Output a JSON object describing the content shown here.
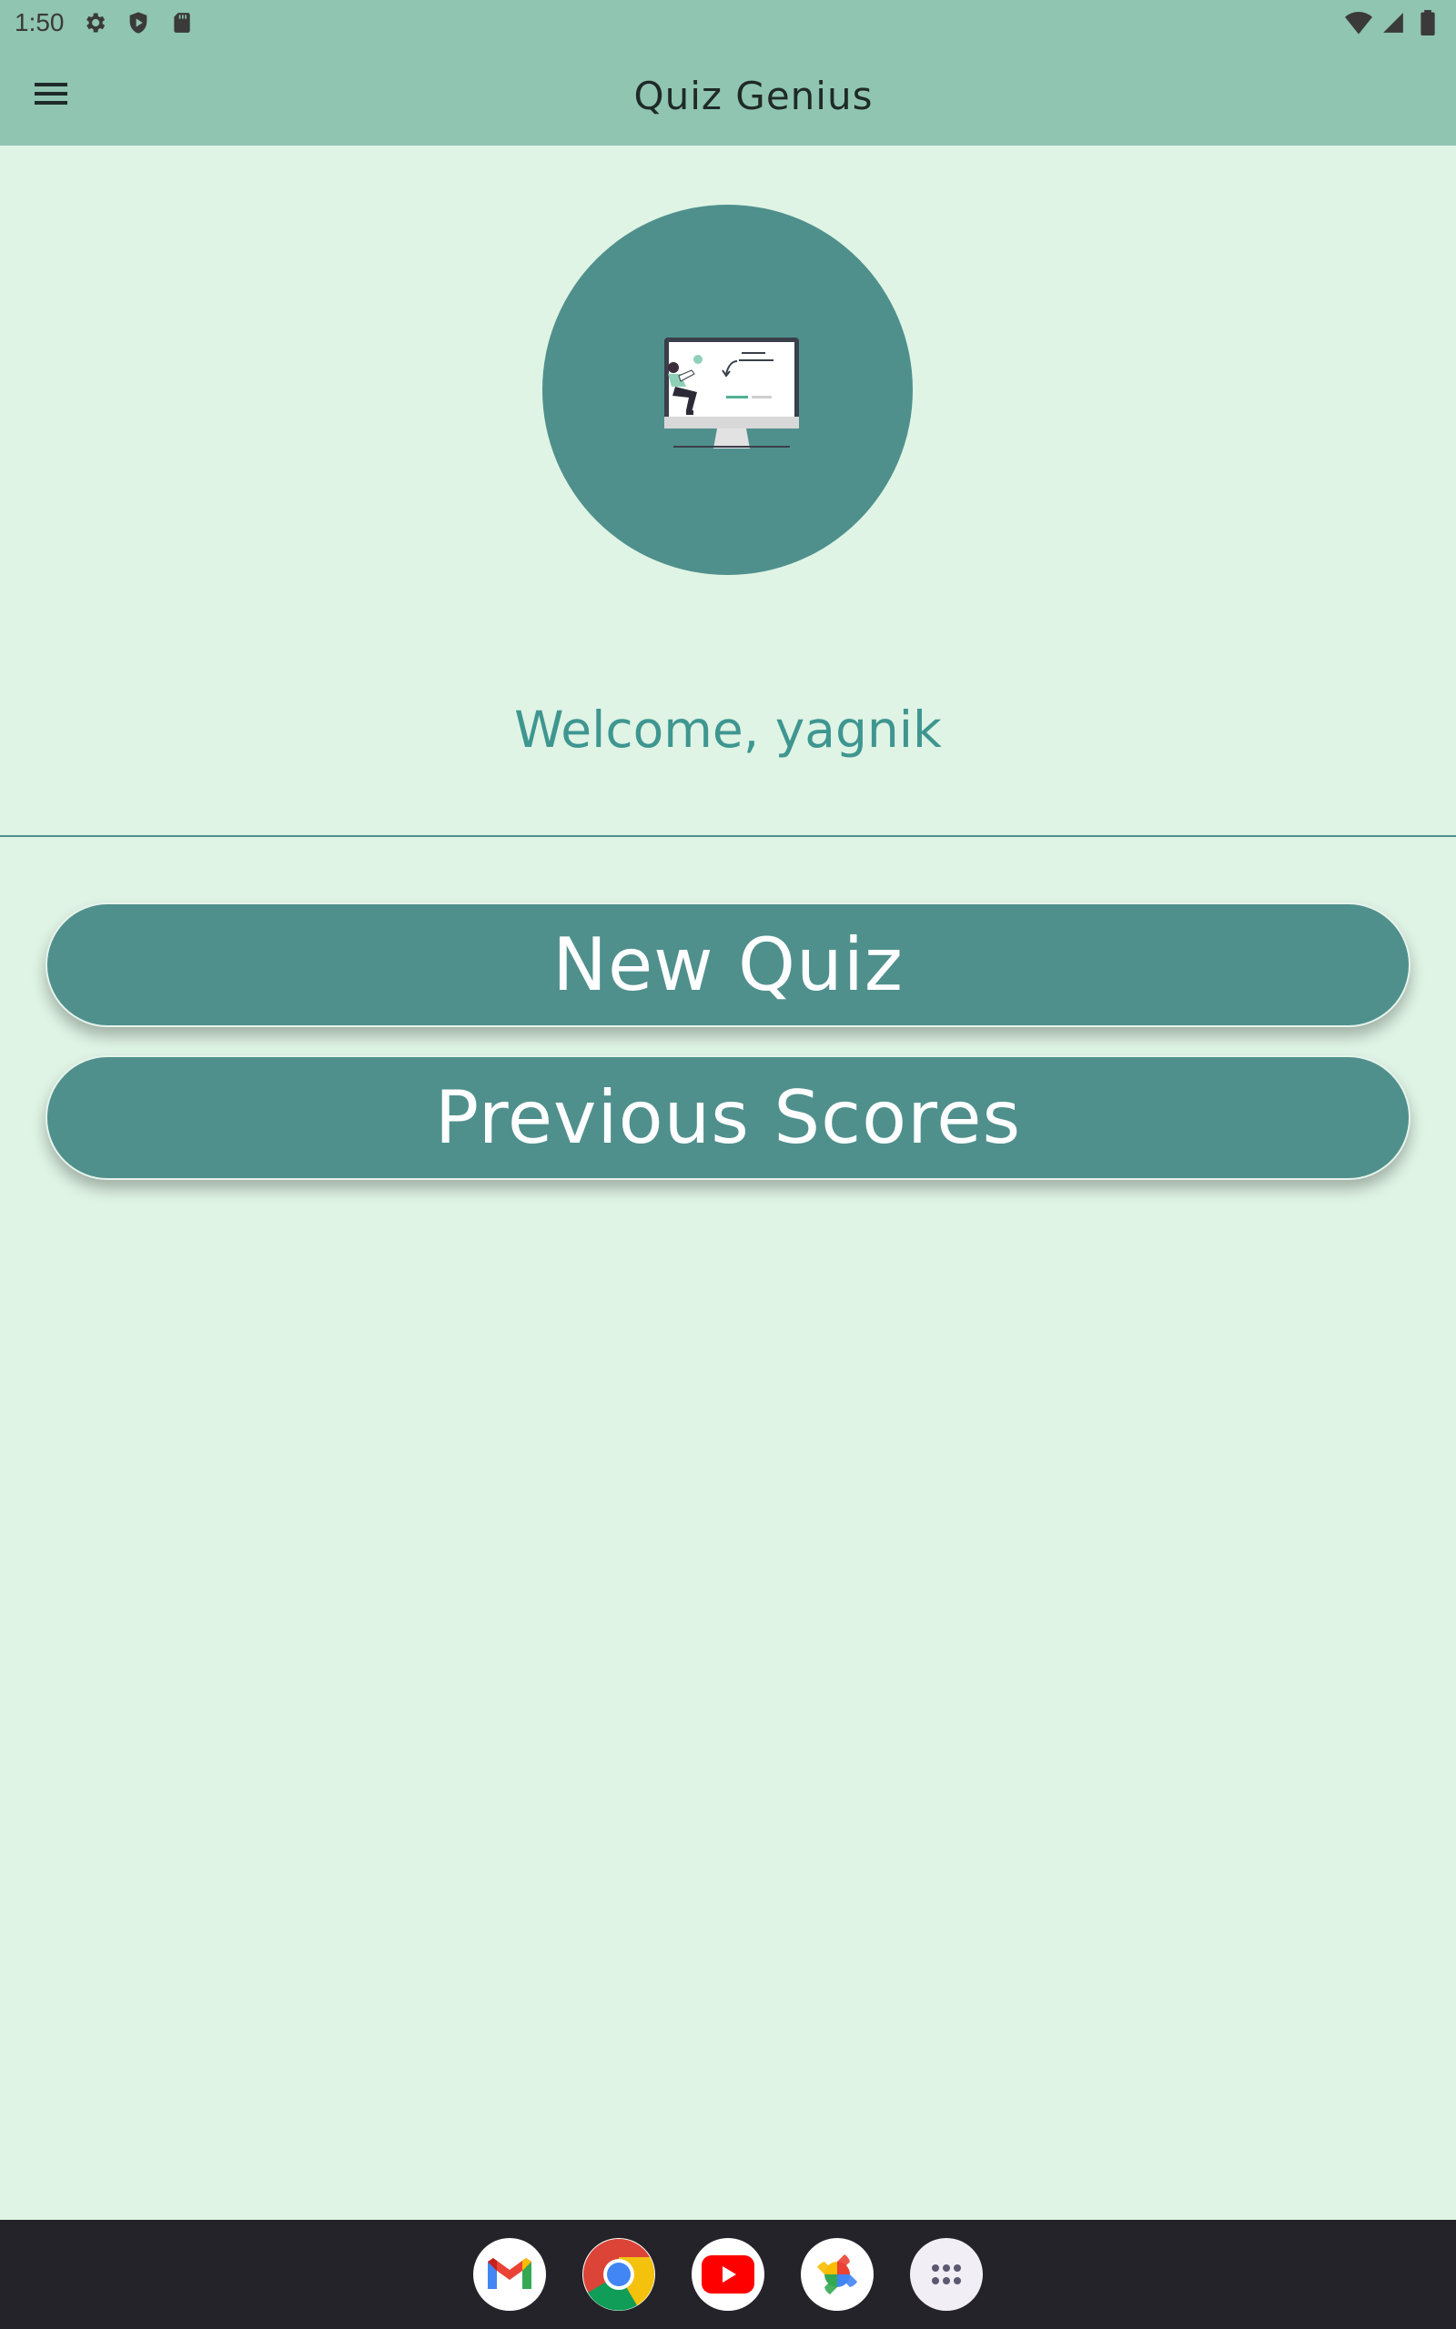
{
  "status_bar": {
    "time": "1:50",
    "left_icons": [
      "settings-icon",
      "play-shield-icon",
      "sd-card-icon"
    ],
    "right_icons": [
      "wifi-icon",
      "cell-signal-icon",
      "battery-icon"
    ]
  },
  "app_bar": {
    "title": "Quiz Genius",
    "menu_icon": "hamburger-menu-icon"
  },
  "hero": {
    "illustration": "computer-illustration",
    "background_color": "#4f908c"
  },
  "welcome_text": "Welcome, yagnik",
  "buttons": {
    "new_quiz": "New Quiz",
    "previous_scores": "Previous Scores"
  },
  "taskbar": {
    "apps": [
      "gmail-icon",
      "chrome-icon",
      "youtube-icon",
      "photos-icon",
      "app-drawer-icon"
    ]
  },
  "colors": {
    "header": "#8fc5b1",
    "background": "#dff4e5",
    "accent": "#4f908c",
    "welcome_text": "#3f9690"
  }
}
